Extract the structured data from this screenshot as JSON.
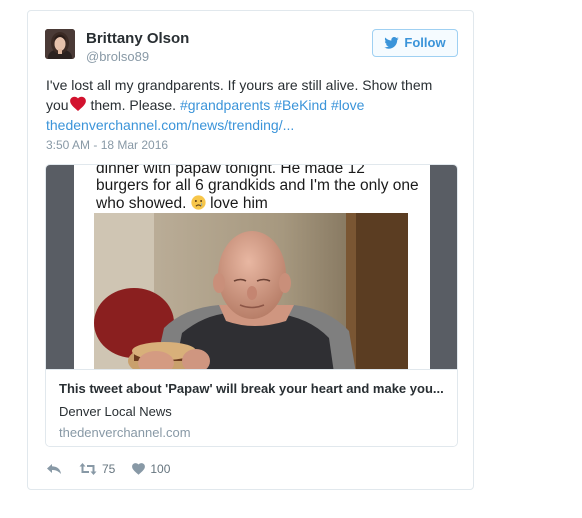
{
  "author": {
    "name": "Brittany Olson",
    "handle": "@brolso89"
  },
  "follow_button": {
    "label": "Follow",
    "icon": "twitter-bird-icon",
    "color": "#3b94d9"
  },
  "tweet": {
    "text_part1": "I've lost all my grandparents. If yours are still alive. Show them you",
    "heart_emoji": "red-heart-icon",
    "text_part2": " them. Please. ",
    "hashtags": [
      "#grandparents",
      "#BeKind",
      "#love"
    ],
    "link": "thedenverchannel.com/news/trending/...",
    "timestamp": "3:50 AM - 18 Mar 2016"
  },
  "card": {
    "image_caption_line1": "dinner with papaw tonight. He made 12",
    "image_caption_line2": "burgers for all 6 grandkids and I'm the only one",
    "image_caption_line3a": "who showed.",
    "image_caption_line3b": " love him",
    "title": "This tweet about 'Papaw' will break your heart and make you...",
    "description": "Denver Local News",
    "domain": "thedenverchannel.com"
  },
  "actions": {
    "reply_icon": "reply-icon",
    "retweet_icon": "retweet-icon",
    "retweet_count": "75",
    "like_icon": "heart-icon",
    "like_count": "100"
  },
  "colors": {
    "link": "#3b94d9",
    "text": "#292f33",
    "muted": "#8899a6",
    "border": "#e1e8ed"
  }
}
